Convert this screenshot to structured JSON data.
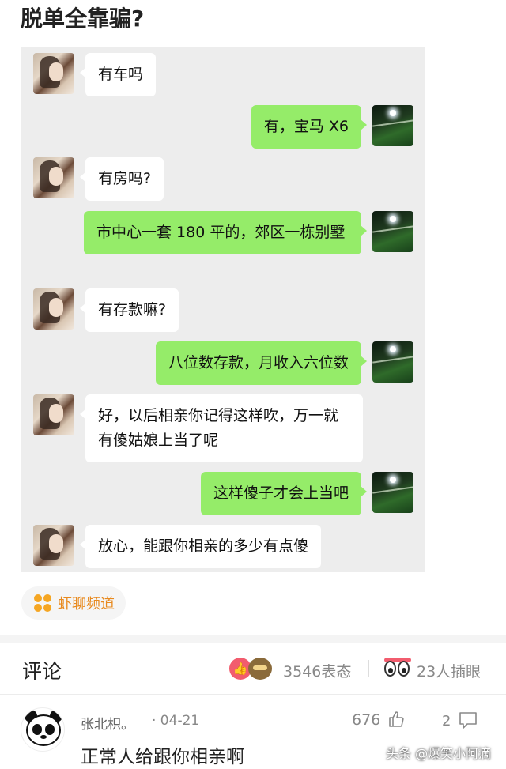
{
  "post": {
    "title": "脱单全靠骗?"
  },
  "chat": {
    "messages": [
      {
        "side": "left",
        "text": "有车吗"
      },
      {
        "side": "right",
        "text": "有，宝马 X6"
      },
      {
        "side": "left",
        "text": "有房吗?"
      },
      {
        "side": "right",
        "text": "市中心一套 180 平的，郊区一栋别墅"
      },
      {
        "side": "left",
        "text": "有存款嘛?"
      },
      {
        "side": "right",
        "text": "八位数存款，月收入六位数"
      },
      {
        "side": "left",
        "text": "好，以后相亲你记得这样吹，万一就有傻姑娘上当了呢"
      },
      {
        "side": "right",
        "text": "这样傻子才会上当吧"
      },
      {
        "side": "left",
        "text": "放心，能跟你相亲的多少有点傻"
      }
    ]
  },
  "channel": {
    "label": "虾聊频道",
    "icon": "clover-icon",
    "color": "#e8891d"
  },
  "comments": {
    "title": "评论",
    "reactions_count": "3546表态",
    "watching_count": "23人插眼",
    "items": [
      {
        "user": "张北枳。",
        "date": "· 04-21",
        "likes": "676",
        "replies": "2",
        "text": "正常人给跟你相亲啊"
      }
    ]
  },
  "watermark": "头条 @爆笑小阿滴"
}
